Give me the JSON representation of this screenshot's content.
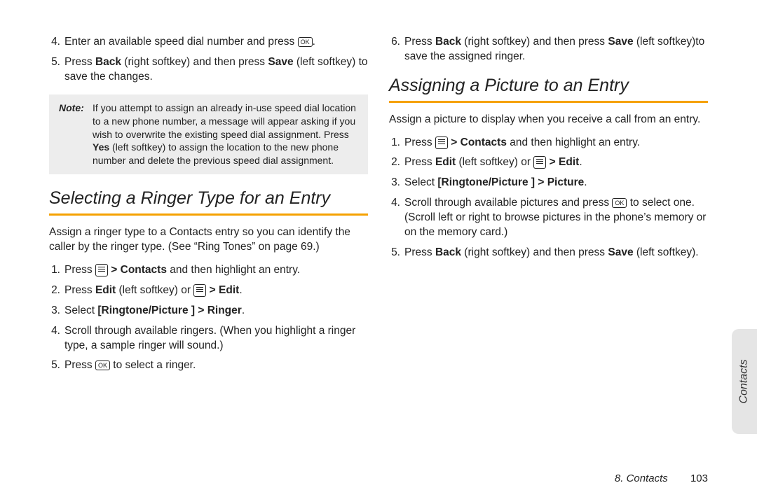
{
  "left": {
    "topSteps": [
      {
        "n": "4.",
        "parts": [
          "Enter an available speed dial number and press ",
          {
            "icon": "ok"
          },
          "."
        ]
      },
      {
        "n": "5.",
        "parts": [
          "Press ",
          {
            "b": "Back"
          },
          " (right softkey) and then press ",
          {
            "b": "Save"
          },
          " (left softkey) to save the changes."
        ]
      }
    ],
    "noteLabel": "Note:",
    "noteParts": [
      "If you attempt to assign an already in-use speed dial location to a new phone number, a message will appear asking if you wish to overwrite the existing speed dial assignment. Press ",
      {
        "b": "Yes"
      },
      " (left softkey) to assign the location to the new phone number and delete the previous speed dial assignment."
    ],
    "heading": "Selecting a Ringer Type for an Entry",
    "intro": "Assign a ringer type to a Contacts entry so you can identify the caller by the ringer type. (See “Ring Tones” on page 69.)",
    "steps": [
      {
        "n": "1.",
        "parts": [
          "Press ",
          {
            "icon": "menu"
          },
          " ",
          {
            "gt": ">"
          },
          " ",
          {
            "b": "Contacts"
          },
          " and then highlight an entry."
        ]
      },
      {
        "n": "2.",
        "parts": [
          "Press ",
          {
            "b": "Edit"
          },
          " (left softkey) or ",
          {
            "icon": "menu"
          },
          " ",
          {
            "gt": ">"
          },
          " ",
          {
            "b": "Edit"
          },
          "."
        ]
      },
      {
        "n": "3.",
        "parts": [
          "Select ",
          {
            "b": "[Ringtone/Picture ]"
          },
          " ",
          {
            "gt": ">"
          },
          " ",
          {
            "b": "Ringer"
          },
          "."
        ]
      },
      {
        "n": "4.",
        "parts": [
          "Scroll through available ringers. (When you highlight a ringer type, a sample ringer will sound.)"
        ]
      },
      {
        "n": "5.",
        "parts": [
          "Press ",
          {
            "icon": "ok"
          },
          " to select a ringer."
        ]
      }
    ]
  },
  "right": {
    "topSteps": [
      {
        "n": "6.",
        "parts": [
          "Press ",
          {
            "b": "Back"
          },
          " (right softkey) and then press ",
          {
            "b": "Save"
          },
          " (left softkey)to save the assigned ringer."
        ]
      }
    ],
    "heading": "Assigning a Picture to an Entry",
    "intro": "Assign a picture to display when you receive a call from an entry.",
    "steps": [
      {
        "n": "1.",
        "parts": [
          "Press ",
          {
            "icon": "menu"
          },
          " ",
          {
            "gt": ">"
          },
          " ",
          {
            "b": "Contacts"
          },
          " and then highlight an entry."
        ]
      },
      {
        "n": "2.",
        "parts": [
          "Press ",
          {
            "b": "Edit"
          },
          " (left softkey) or ",
          {
            "icon": "menu"
          },
          " ",
          {
            "gt": ">"
          },
          " ",
          {
            "b": "Edit"
          },
          "."
        ]
      },
      {
        "n": "3.",
        "parts": [
          "Select ",
          {
            "b": "[Ringtone/Picture ]"
          },
          " ",
          {
            "gt": ">"
          },
          " ",
          {
            "b": "Picture"
          },
          "."
        ]
      },
      {
        "n": "4.",
        "parts": [
          "Scroll through available pictures and press ",
          {
            "icon": "ok"
          },
          " to select one. (Scroll left or right  to browse pictures in the phone’s memory or on the memory card.)"
        ]
      },
      {
        "n": "5.",
        "parts": [
          "Press ",
          {
            "b": "Back"
          },
          " (right softkey) and then press ",
          {
            "b": "Save"
          },
          " (left softkey)."
        ]
      }
    ]
  },
  "sideTab": "Contacts",
  "footer": {
    "chapter": "8. Contacts",
    "page": "103"
  },
  "icons": {
    "ok": "OK"
  }
}
